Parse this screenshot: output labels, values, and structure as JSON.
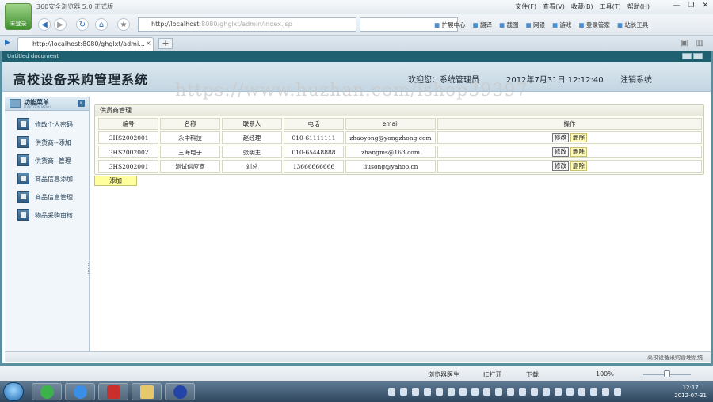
{
  "browser": {
    "app_title": "360安全浏览器 5.0 正式版",
    "logo_label": "未登录",
    "menu": [
      "文件(F)",
      "查看(V)",
      "收藏(B)",
      "工具(T)",
      "帮助(H)"
    ],
    "window_controls": [
      "—",
      "❐",
      "✕"
    ],
    "address_host": "http://localhost",
    "address_rest": ":8080/ghglxt/admin/index.jsp",
    "toolbar_items": [
      "扩展中心",
      "翻译",
      "截图",
      "网银",
      "游戏",
      "登录管家",
      "站长工具"
    ],
    "tab_label": "http://localhost:8080/ghglxt/admi...",
    "tab_close": "×",
    "new_tab": "+",
    "sidebar_toggle": "▶"
  },
  "page": {
    "strip_text": "Untitled document",
    "system_title": "高校设备采购管理系统",
    "welcome": "欢迎您：系统管理员",
    "datetime": "2012年7月31日  12:12:40",
    "logout": "注销系统",
    "watermark": "https://www.huzhan.com/ishop39397"
  },
  "sidebar": {
    "title": "功能菜单",
    "subtitle": "FUNCTION MENU",
    "collapse_icon": "»",
    "items": [
      {
        "label": "修改个人密码"
      },
      {
        "label": "供货商--添加"
      },
      {
        "label": "供货商--管理"
      },
      {
        "label": "商品信息添加"
      },
      {
        "label": "商品信息管理"
      },
      {
        "label": "物品采购审核"
      }
    ]
  },
  "panel": {
    "title": "供货商管理",
    "columns": [
      "编号",
      "名称",
      "联系人",
      "电话",
      "email",
      "操作"
    ],
    "edit_label": "修改",
    "delete_label": "删除",
    "rows": [
      {
        "id": "GHS2002001",
        "name": "永中科技",
        "contact": "赵经理",
        "phone": "010-61111111",
        "email": "zhaoyong@yongzhong.com"
      },
      {
        "id": "GHS2002002",
        "name": "三海电子",
        "contact": "张明主",
        "phone": "010-65448888",
        "email": "zhangms@163.com"
      },
      {
        "id": "GHS2002001",
        "name": "测试供应商",
        "contact": "刘总",
        "phone": "13666666666",
        "email": "liusong@yahoo.cn"
      }
    ],
    "add_label": "添加"
  },
  "footer": {
    "text": "高校设备采购管理系统"
  },
  "statusbar": {
    "items": [
      "浏览器医生",
      "IE打开",
      "下载",
      "100%"
    ]
  },
  "taskbar": {
    "time": "12:17",
    "date": "2012-07-31"
  }
}
